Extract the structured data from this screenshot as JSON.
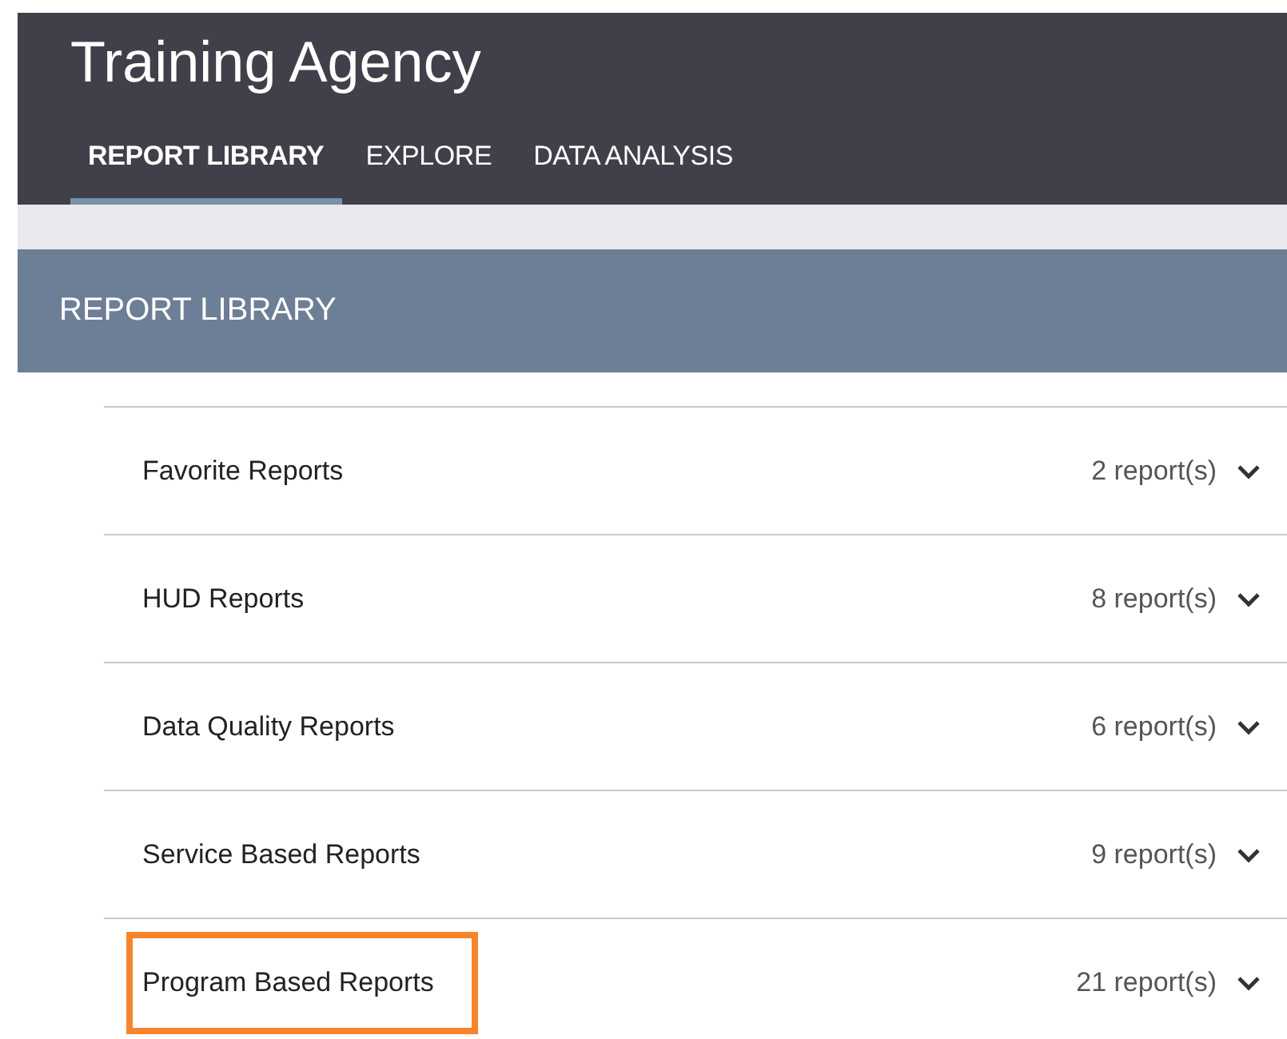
{
  "app": {
    "title": "Training Agency"
  },
  "tabs": [
    {
      "label": "REPORT LIBRARY",
      "selected": true
    },
    {
      "label": "EXPLORE",
      "selected": false
    },
    {
      "label": "DATA ANALYSIS",
      "selected": false
    }
  ],
  "section": {
    "title": "REPORT LIBRARY"
  },
  "groups": [
    {
      "name": "Favorite Reports",
      "count": "2 report(s)",
      "highlighted": false
    },
    {
      "name": "HUD Reports",
      "count": "8 report(s)",
      "highlighted": false
    },
    {
      "name": "Data Quality Reports",
      "count": "6 report(s)",
      "highlighted": false
    },
    {
      "name": "Service Based Reports",
      "count": "9 report(s)",
      "highlighted": false
    },
    {
      "name": "Program Based Reports",
      "count": "21 report(s)",
      "highlighted": true
    }
  ]
}
